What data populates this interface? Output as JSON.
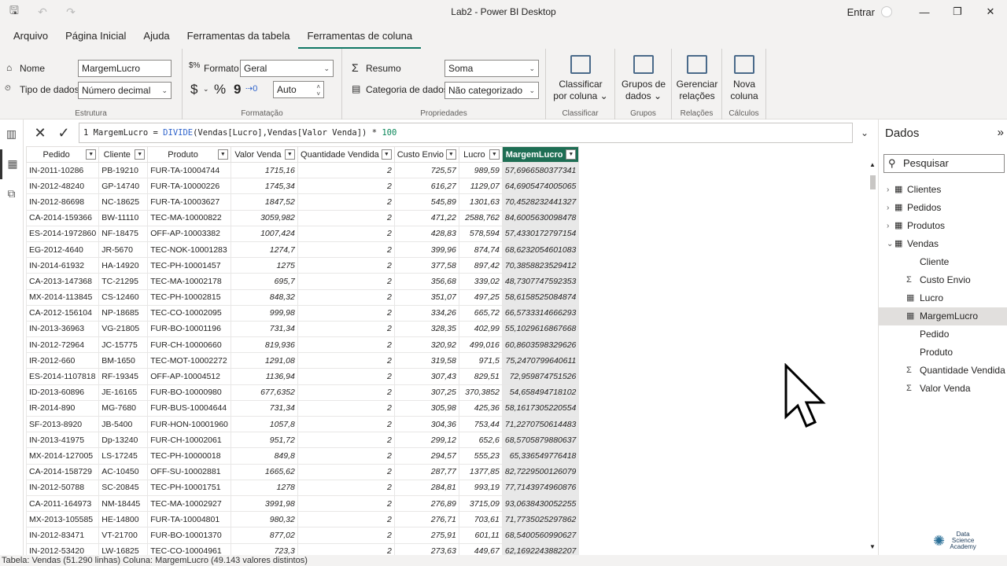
{
  "window": {
    "title": "Lab2 - Power BI Desktop",
    "signin": "Entrar"
  },
  "menu": [
    "Arquivo",
    "Página Inicial",
    "Ajuda",
    "Ferramentas da tabela",
    "Ferramentas de coluna"
  ],
  "ribbon": {
    "estrutura": {
      "label": "Estrutura",
      "name_label": "Nome",
      "name_value": "MargemLucro",
      "type_label": "Tipo de dados",
      "type_value": "Número decimal"
    },
    "formatacao": {
      "label": "Formatação",
      "format_label": "Formato",
      "format_value": "Geral",
      "currency": "$",
      "percent": "%",
      "comma": "9",
      "decimals": "Auto"
    },
    "propriedades": {
      "label": "Propriedades",
      "summary_label": "Resumo",
      "summary_value": "Soma",
      "category_label": "Categoria de dados",
      "category_value": "Não categorizado"
    },
    "classificar": {
      "label": "Classificar",
      "button": "Classificar por coluna"
    },
    "grupos": {
      "label": "Grupos",
      "button": "Grupos de dados"
    },
    "relacoes": {
      "label": "Relações",
      "button": "Gerenciar relações"
    },
    "calculos": {
      "label": "Cálculos",
      "button": "Nova coluna"
    }
  },
  "formula": {
    "line": "1",
    "name": "MargemLucro",
    "eq": " = ",
    "fn": "DIVIDE",
    "args": "(Vendas[Lucro],Vendas[Valor Venda])",
    "op": " * ",
    "num": "100"
  },
  "table": {
    "columns": [
      "Pedido",
      "Cliente",
      "Produto",
      "Valor Venda",
      "Quantidade Vendida",
      "Custo Envio",
      "Lucro",
      "MargemLucro"
    ],
    "rows": [
      [
        "IN-2011-10286",
        "PB-19210",
        "FUR-TA-10004744",
        "1715,16",
        "2",
        "725,57",
        "989,59",
        "57,6966580377341"
      ],
      [
        "IN-2012-48240",
        "GP-14740",
        "FUR-TA-10000226",
        "1745,34",
        "2",
        "616,27",
        "1129,07",
        "64,6905474005065"
      ],
      [
        "IN-2012-86698",
        "NC-18625",
        "FUR-TA-10003627",
        "1847,52",
        "2",
        "545,89",
        "1301,63",
        "70,4528232441327"
      ],
      [
        "CA-2014-159366",
        "BW-11110",
        "TEC-MA-10000822",
        "3059,982",
        "2",
        "471,22",
        "2588,762",
        "84,6005630098478"
      ],
      [
        "ES-2014-1972860",
        "NF-18475",
        "OFF-AP-10003382",
        "1007,424",
        "2",
        "428,83",
        "578,594",
        "57,4330172797154"
      ],
      [
        "EG-2012-4640",
        "JR-5670",
        "TEC-NOK-10001283",
        "1274,7",
        "2",
        "399,96",
        "874,74",
        "68,6232054601083"
      ],
      [
        "IN-2014-61932",
        "HA-14920",
        "TEC-PH-10001457",
        "1275",
        "2",
        "377,58",
        "897,42",
        "70,3858823529412"
      ],
      [
        "CA-2013-147368",
        "TC-21295",
        "TEC-MA-10002178",
        "695,7",
        "2",
        "356,68",
        "339,02",
        "48,7307747592353"
      ],
      [
        "MX-2014-113845",
        "CS-12460",
        "TEC-PH-10002815",
        "848,32",
        "2",
        "351,07",
        "497,25",
        "58,6158525084874"
      ],
      [
        "CA-2012-156104",
        "NP-18685",
        "TEC-CO-10002095",
        "999,98",
        "2",
        "334,26",
        "665,72",
        "66,5733314666293"
      ],
      [
        "IN-2013-36963",
        "VG-21805",
        "FUR-BO-10001196",
        "731,34",
        "2",
        "328,35",
        "402,99",
        "55,1029616867668"
      ],
      [
        "IN-2012-72964",
        "JC-15775",
        "FUR-CH-10000660",
        "819,936",
        "2",
        "320,92",
        "499,016",
        "60,8603598329626"
      ],
      [
        "IR-2012-660",
        "BM-1650",
        "TEC-MOT-10002272",
        "1291,08",
        "2",
        "319,58",
        "971,5",
        "75,2470799640611"
      ],
      [
        "ES-2014-1107818",
        "RF-19345",
        "OFF-AP-10004512",
        "1136,94",
        "2",
        "307,43",
        "829,51",
        "72,959874751526"
      ],
      [
        "ID-2013-60896",
        "JE-16165",
        "FUR-BO-10000980",
        "677,6352",
        "2",
        "307,25",
        "370,3852",
        "54,658494718102"
      ],
      [
        "IR-2014-890",
        "MG-7680",
        "FUR-BUS-10004644",
        "731,34",
        "2",
        "305,98",
        "425,36",
        "58,1617305220554"
      ],
      [
        "SF-2013-8920",
        "JB-5400",
        "FUR-HON-10001960",
        "1057,8",
        "2",
        "304,36",
        "753,44",
        "71,2270750614483"
      ],
      [
        "IN-2013-41975",
        "Dp-13240",
        "FUR-CH-10002061",
        "951,72",
        "2",
        "299,12",
        "652,6",
        "68,5705879880637"
      ],
      [
        "MX-2014-127005",
        "LS-17245",
        "TEC-PH-10000018",
        "849,8",
        "2",
        "294,57",
        "555,23",
        "65,336549776418"
      ],
      [
        "CA-2014-158729",
        "AC-10450",
        "OFF-SU-10002881",
        "1665,62",
        "2",
        "287,77",
        "1377,85",
        "82,7229500126079"
      ],
      [
        "IN-2012-50788",
        "SC-20845",
        "TEC-PH-10001751",
        "1278",
        "2",
        "284,81",
        "993,19",
        "77,7143974960876"
      ],
      [
        "CA-2011-164973",
        "NM-18445",
        "TEC-MA-10002927",
        "3991,98",
        "2",
        "276,89",
        "3715,09",
        "93,0638430052255"
      ],
      [
        "MX-2013-105585",
        "HE-14800",
        "FUR-TA-10004801",
        "980,32",
        "2",
        "276,71",
        "703,61",
        "71,7735025297862"
      ],
      [
        "IN-2012-83471",
        "VT-21700",
        "FUR-BO-10001370",
        "877,02",
        "2",
        "275,91",
        "601,11",
        "68,5400560990627"
      ],
      [
        "IN-2012-53420",
        "LW-16825",
        "TEC-CO-10004961",
        "723,3",
        "2",
        "273,63",
        "449,67",
        "62,1692243882207"
      ]
    ]
  },
  "status": "Tabela: Vendas (51.290 linhas) Coluna: MargemLucro (49.143 valores distintos)",
  "pane": {
    "title": "Dados",
    "search_placeholder": "Pesquisar",
    "tables": [
      {
        "name": "Clientes"
      },
      {
        "name": "Pedidos"
      },
      {
        "name": "Produtos"
      }
    ],
    "expanded": "Vendas",
    "fields": [
      {
        "name": "Cliente",
        "icon": ""
      },
      {
        "name": "Custo Envio",
        "icon": "Σ"
      },
      {
        "name": "Lucro",
        "icon": "▦"
      },
      {
        "name": "MargemLucro",
        "icon": "▦"
      },
      {
        "name": "Pedido",
        "icon": ""
      },
      {
        "name": "Produto",
        "icon": ""
      },
      {
        "name": "Quantidade Vendida",
        "icon": "Σ"
      },
      {
        "name": "Valor Venda",
        "icon": "Σ"
      }
    ]
  },
  "logo": "Data Science Academy",
  "colors": {
    "accent": "#117865",
    "selected_header": "#1e6e54"
  }
}
